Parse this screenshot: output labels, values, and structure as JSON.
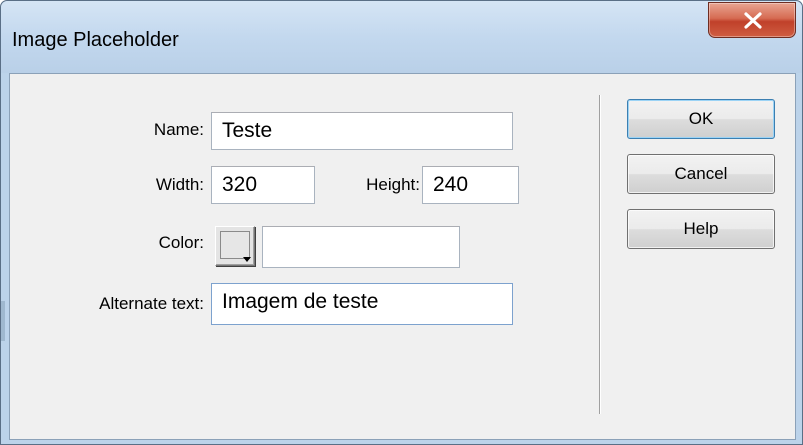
{
  "window": {
    "title": "Image Placeholder"
  },
  "form": {
    "name_label": "Name:",
    "name_value": "Teste",
    "width_label": "Width:",
    "width_value": "320",
    "height_label": "Height:",
    "height_value": "240",
    "color_label": "Color:",
    "color_value": "",
    "alt_label": "Alternate text:",
    "alt_value": "Imagem de teste"
  },
  "buttons": {
    "ok": "OK",
    "cancel": "Cancel",
    "help": "Help"
  },
  "icons": {
    "close": "close-icon",
    "color_dropdown": "dropdown-arrow-icon"
  },
  "colors": {
    "close_button": "#c7462d",
    "titlebar": "#c3d8ee",
    "dialog_background": "#f0f0f0"
  }
}
